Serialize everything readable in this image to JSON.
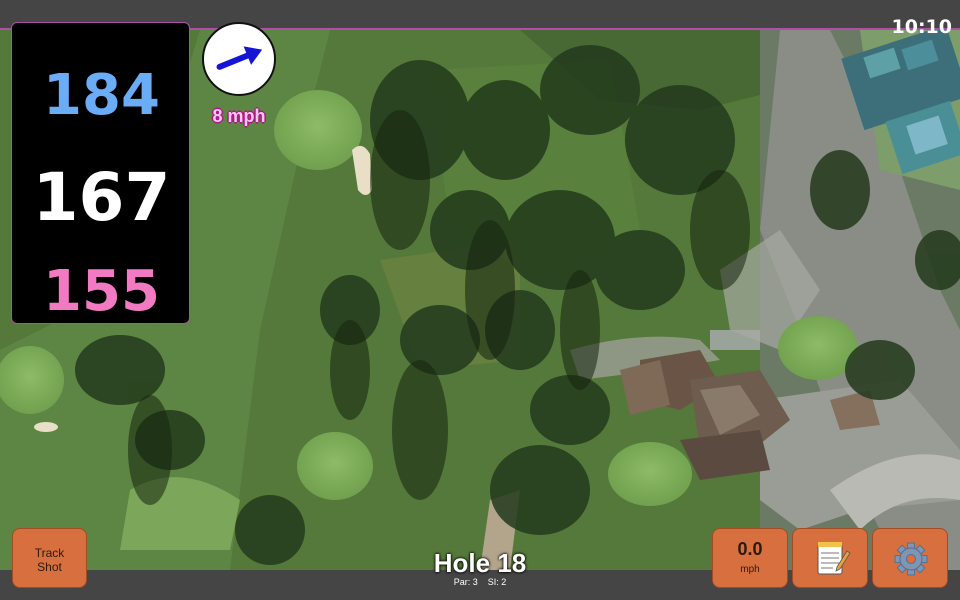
{
  "status_bar": {
    "time": "10:10"
  },
  "distances": {
    "back": "184",
    "middle": "167",
    "front": "155"
  },
  "wind": {
    "speed": "8 mph",
    "direction_icon": "arrow-icon"
  },
  "hole": {
    "title": "Hole 18",
    "par": "Par: 3",
    "stroke_index": "SI: 2"
  },
  "buttons": {
    "track_shot": [
      "Track",
      "Shot"
    ],
    "speed_value": "0.0",
    "speed_unit": "mph",
    "notes_icon": "notepad-icon",
    "settings_icon": "gear-icon"
  },
  "colors": {
    "back_distance": "#6aacf5",
    "middle_distance": "#ffffff",
    "front_distance": "#f27ac3",
    "button": "#d86f3e",
    "accent_border": "#b04fa8"
  }
}
